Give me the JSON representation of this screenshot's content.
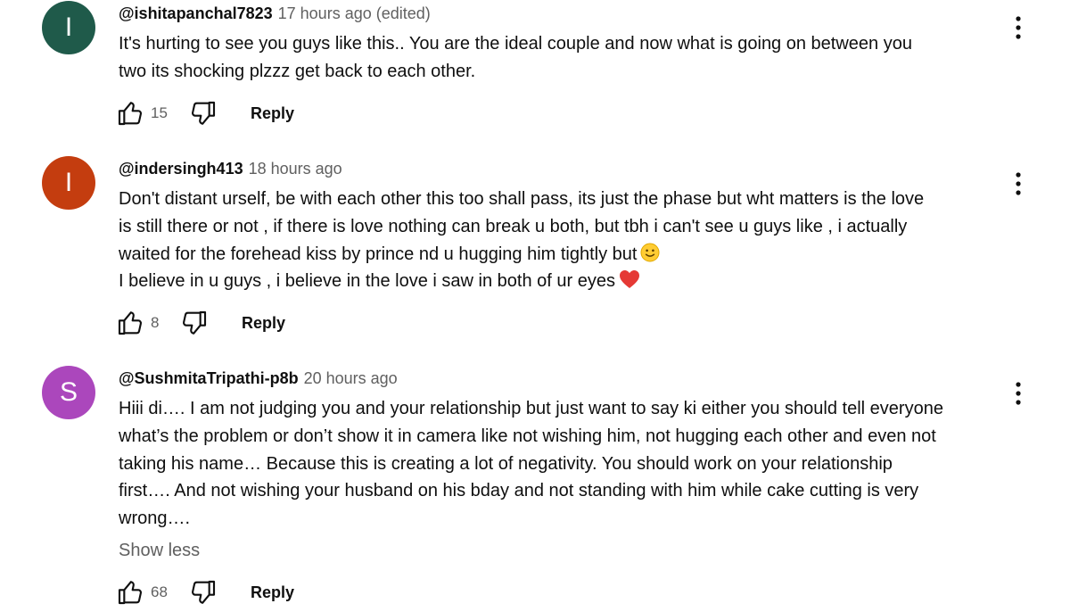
{
  "comments": [
    {
      "avatar_letter": "I",
      "avatar_color": "#1f5a4a",
      "author": "@ishitapanchal7823",
      "meta": "17 hours ago (edited)",
      "lines": [
        "It's hurting to see you guys like this.. You are the ideal couple and now what is going on between you",
        "two its shocking plzzz get back to each other."
      ],
      "likes": "15",
      "reply_label": "Reply"
    },
    {
      "avatar_letter": "I",
      "avatar_color": "#c43d0f",
      "author": "@indersingh413",
      "meta": "18 hours ago",
      "lines": [
        "Don't distant urself, be with each other this too shall pass, its just the phase but wht matters is the love",
        "is still there or not , if there is love nothing can break u both, but tbh i can't see u guys like , i actually",
        "waited for the forehead kiss by prince nd u hugging him tightly but",
        "I believe in u guys , i believe in the love i saw in both of ur eyes"
      ],
      "likes": "8",
      "reply_label": "Reply"
    },
    {
      "avatar_letter": "S",
      "avatar_color": "#ab47bc",
      "author": "@SushmitaTripathi-p8b",
      "meta": "20 hours ago",
      "lines": [
        "Hiii di…. I am not judging you and your relationship but just want to say ki either you should tell everyone",
        "what’s the problem or don’t show it in camera like not wishing him, not hugging each other and even not",
        "taking his name… Because this is creating a lot of negativity. You should work on your relationship",
        "first…. And not wishing your husband on his bday and not standing with him while cake cutting is very",
        "wrong…."
      ],
      "show_less": "Show less",
      "likes": "68",
      "reply_label": "Reply"
    }
  ],
  "icons": {
    "like": "thumbs-up-icon",
    "dislike": "thumbs-down-icon",
    "more": "more-vertical-icon",
    "smile": "slightly-smiling-face-emoji",
    "heart": "red-heart-emoji"
  }
}
